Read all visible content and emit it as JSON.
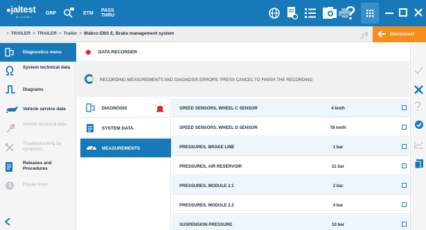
{
  "app": {
    "logo_text": "jaltest",
    "logo_sub": "BY COJALI",
    "mode_grp": "GRP",
    "mode_etm": "ETM",
    "pass_top": "PASS",
    "pass_bottom": "THRU"
  },
  "breadcrumb": {
    "items": [
      "TRAILER",
      "TRAILER",
      "Trailer",
      "Wabco EBS E, Brake management system"
    ],
    "separator": ">"
  },
  "actions": {
    "disconnect_label": "Disconnect"
  },
  "sidebar": {
    "items": [
      {
        "label": "Diagnostics menu",
        "icon": "diagnostics-icon",
        "state": "active"
      },
      {
        "label": "System technical data",
        "icon": "omega-icon",
        "state": "normal"
      },
      {
        "label": "Diagrams",
        "icon": "diagram-icon",
        "state": "normal"
      },
      {
        "label": "Vehicle service data",
        "icon": "oil-can-icon",
        "state": "normal"
      },
      {
        "label": "Vehicle technical data",
        "icon": "wrench-icon",
        "state": "disabled"
      },
      {
        "label": "Troubleshooting by symptoms",
        "icon": "tools-icon",
        "state": "disabled"
      },
      {
        "label": "Releases and Procedures",
        "icon": "procedures-icon",
        "state": "normal"
      },
      {
        "label": "Repair times",
        "icon": "repair-time-icon",
        "state": "disabled"
      }
    ]
  },
  "main": {
    "title": "DATA RECORDER",
    "status_message": "RECORDING MEASUREMENTS AND DIAGNOSIS ERRORS. PRESS CANCEL TO FINISH THE RECORDING",
    "categories": [
      {
        "label": "DIAGNOSIS",
        "icon": "diagnosis-icon",
        "active": false,
        "alert": true
      },
      {
        "label": "SYSTEM DATA",
        "icon": "document-icon",
        "active": false,
        "alert": false
      },
      {
        "label": "MEASUREMENTS",
        "icon": "gauge-icon",
        "active": true,
        "alert": false
      }
    ],
    "measurements": [
      {
        "name": "SPEED SENSORS, WHEEL C SENSOR",
        "value": "4 km/h",
        "checked": false
      },
      {
        "name": "SPEED SENSORS, WHEEL D SENSOR",
        "value": "78 km/h",
        "checked": false
      },
      {
        "name": "PRESSURES, BRAKE LINE",
        "value": "1 bar",
        "checked": false
      },
      {
        "name": "PRESSURES, AIR RESERVOIR",
        "value": "11 bar",
        "checked": false
      },
      {
        "name": "PRESSURES, MODULE 2.1",
        "value": "2 bar",
        "checked": false
      },
      {
        "name": "PRESSURES, MODULE 2.2",
        "value": "4 bar",
        "checked": false
      },
      {
        "name": "SUSPENSION PRESSURE",
        "value": "10 bar",
        "checked": false
      }
    ]
  },
  "colors": {
    "primary": "#1779b8",
    "accent": "#f38e1d",
    "record": "#d62b2b",
    "row_alt": "#eef5fb",
    "disabled_text": "#aab4bd"
  }
}
